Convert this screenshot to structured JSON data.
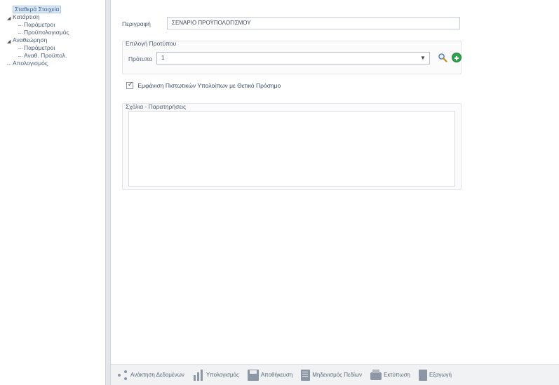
{
  "tree": {
    "items": [
      {
        "label": "Σταθερά Στοιχεία",
        "level": 0,
        "selected": true,
        "expander": ""
      },
      {
        "label": "Κατάρτιση",
        "level": 0,
        "selected": false,
        "expander": "◢"
      },
      {
        "label": "Παράμετροι",
        "level": 1,
        "selected": false,
        "expander": ""
      },
      {
        "label": "Προϋπολογισμός",
        "level": 1,
        "selected": false,
        "expander": ""
      },
      {
        "label": "Αναθεώρηση",
        "level": 0,
        "selected": false,
        "expander": "◢"
      },
      {
        "label": "Παράμετροι",
        "level": 1,
        "selected": false,
        "expander": ""
      },
      {
        "label": "Αναθ. Προϋπολ.",
        "level": 1,
        "selected": false,
        "expander": ""
      },
      {
        "label": "Απολογισμός",
        "level": 0,
        "selected": false,
        "expander": ""
      }
    ]
  },
  "form": {
    "description_label": "Περιγραφή",
    "description_value": "ΣΕΝΑΡΙΟ ΠΡΟΫΠΟΛΟΓΙΣΜΟΥ",
    "template_group_title": "Επιλογή Προτύπου",
    "template_label": "Πρότυπο",
    "template_value": "1",
    "checkbox_label": "Εμφάνιση Πιστωτικών Υπολοίπων με Θετικό Πρόσημο",
    "checkbox_checked": true,
    "notes_group_title": "Σχόλια - Παρατηρήσεις",
    "notes_value": ""
  },
  "toolbar": {
    "buttons": [
      {
        "label": "Ανάκτηση Δεδομένων",
        "icon": "share-icon"
      },
      {
        "label": "Υπολογισμός",
        "icon": "bars-icon"
      },
      {
        "label": "Αποθήκευση",
        "icon": "save-icon"
      },
      {
        "label": "Μηδενισμός Πεδίων",
        "icon": "document-icon"
      },
      {
        "label": "Εκτύπωση",
        "icon": "printer-icon"
      },
      {
        "label": "Εξαγωγή",
        "icon": "export-icon"
      }
    ]
  },
  "colors": {
    "selection_bg": "#dce9f7",
    "add_button": "#2ea44f"
  }
}
